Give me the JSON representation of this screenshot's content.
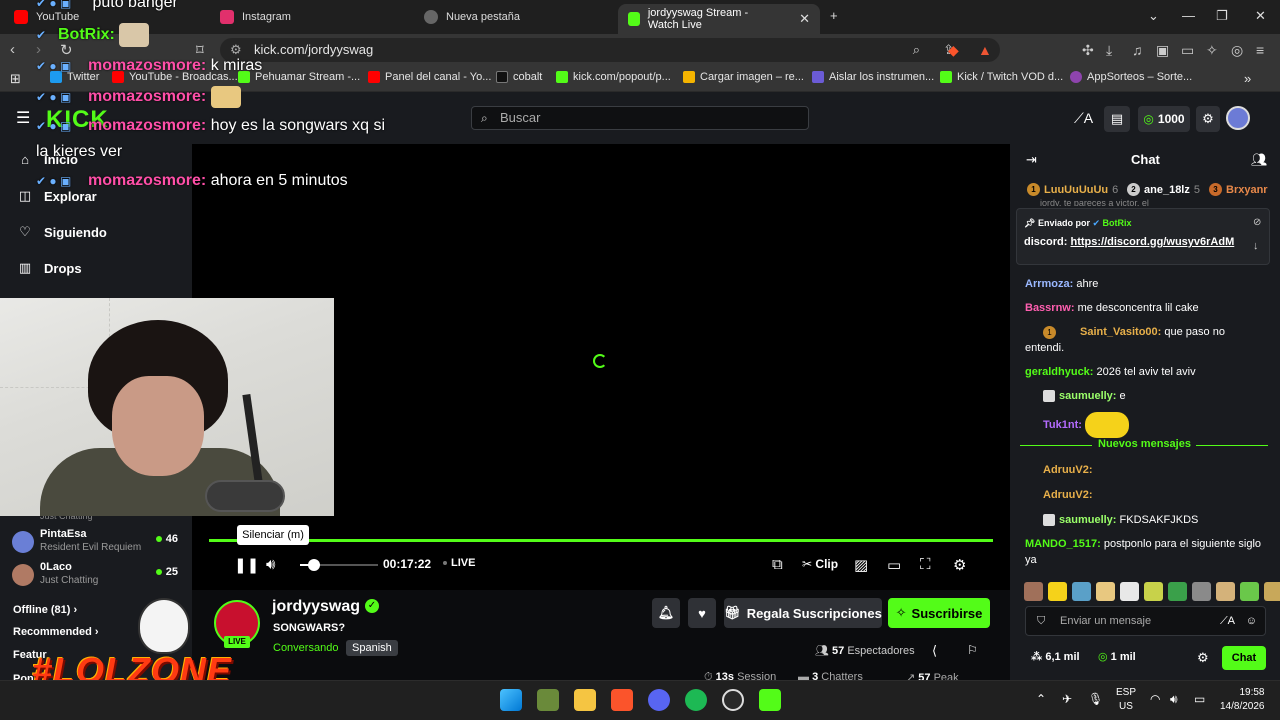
{
  "browser": {
    "tabs": [
      {
        "title": "YouTube",
        "color": "#ff0000"
      },
      {
        "title": "Instagram",
        "color": "#e1306c"
      },
      {
        "title": "Nueva pestaña",
        "color": "#888888"
      },
      {
        "title": "jordyyswag Stream - Watch Live",
        "color": "#53fc18"
      }
    ],
    "url": "kick.com/jordyyswag",
    "bookmarks": [
      {
        "label": "Twitter",
        "color": "#1d9bf0"
      },
      {
        "label": "YouTube - Broadcas...",
        "color": "#ff0000"
      },
      {
        "label": "Pehuamar Stream -...",
        "color": "#53fc18"
      },
      {
        "label": "Panel del canal - Yo...",
        "color": "#ff0000"
      },
      {
        "label": "cobalt",
        "color": "#111111"
      },
      {
        "label": "kick.com/popout/p...",
        "color": "#53fc18"
      },
      {
        "label": "Cargar imagen – re...",
        "color": "#f5b400"
      },
      {
        "label": "Aislar los instrumen...",
        "color": "#6b5bd6"
      },
      {
        "label": "Kick / Twitch VOD d...",
        "color": "#53fc18"
      },
      {
        "label": "AppSorteos – Sorte...",
        "color": "#8e44ad"
      }
    ]
  },
  "kick": {
    "logo": "KICK",
    "search_placeholder": "Buscar",
    "coins": "1000"
  },
  "sidebar": {
    "items": [
      {
        "label": "Inicio"
      },
      {
        "label": "Explorar"
      },
      {
        "label": "Siguiendo"
      },
      {
        "label": "Drops"
      }
    ],
    "partial_game": "Just Chatting",
    "channels": [
      {
        "name": "PintaEsa",
        "game": "Resident Evil Requiem",
        "viewers": "46",
        "color": "#6a7fd6"
      },
      {
        "name": "0Laco",
        "game": "Just Chatting",
        "viewers": "25",
        "color": "#b07a64"
      }
    ],
    "offline": "Offline (81)",
    "recommended": "Recommended",
    "featured": "Featur",
    "partial_link": "Pon"
  },
  "overlay_chat": [
    {
      "user": "",
      "text": "puto banger",
      "bot": false
    },
    {
      "user": "BotRix:",
      "text": "",
      "bot": true
    },
    {
      "user": "momazosmore:",
      "text": "k miras",
      "bot": false
    },
    {
      "user": "momazosmore:",
      "text": "",
      "bot": false
    },
    {
      "user": "momazosmore:",
      "text": "hoy es la songwars xq si",
      "bot": false
    },
    {
      "user": "",
      "text": "la kieres ver",
      "bot": false
    },
    {
      "user": "momazosmore:",
      "text": "ahora en 5 minutos",
      "bot": false
    }
  ],
  "player": {
    "tooltip": "Silenciar (m)",
    "time": "00:17:22",
    "live": "LIVE",
    "clip": "Clip",
    "volume": 0.18
  },
  "stream": {
    "streamer": "jordyyswag",
    "live_tag": "LIVE",
    "title": "SONGWARS?",
    "category": "Conversando",
    "language": "Spanish",
    "gift_label": "Regala Suscripciones",
    "subscribe_label": "Suscribirse",
    "viewers_count": "57",
    "viewers_label": "Espectadores",
    "session_value": "13s",
    "session_label": "Session",
    "chatters_value": "3",
    "chatters_label": "Chatters",
    "peak_value": "57",
    "peak_label": "Peak"
  },
  "overlay_graphics": {
    "lolzone": "#LOLZONE"
  },
  "chat": {
    "title": "Chat",
    "leaderboard": [
      {
        "name": "LuuUuUuUu",
        "count": "6",
        "color": "#e8b04a"
      },
      {
        "name": "ane_18lz",
        "count": "5",
        "color": "#ffffff"
      },
      {
        "name": "Brxyanr",
        "count": "",
        "color": "#e8894a"
      }
    ],
    "cut_line": "jordy, te pareces a victor, el",
    "pinned_by": "Enviado por",
    "pinned_user": "BotRix",
    "pinned_label": "discord:",
    "pinned_link": "https://discord.gg/wusyv6rAdM",
    "messages": [
      {
        "user": "Arrmoza:",
        "text": "ahre",
        "color": "#9ab8ff"
      },
      {
        "user": "Bassrnw:",
        "text": "me desconcentra lil cake",
        "color": "#ff5fb0"
      },
      {
        "user": "Saint_Vasito00:",
        "text": "que paso no",
        "text2": "entendi.",
        "color": "#e8b04a"
      },
      {
        "user": "geraldhyuck:",
        "text": "2026 tel aviv tel aviv",
        "color": "#53fc18"
      },
      {
        "user": "saumuelly:",
        "text": "e",
        "color": "#9bff6a"
      },
      {
        "user": "Tuk1nt:",
        "text": "",
        "color": "#b46bff"
      },
      {
        "user": "AdruuV2:",
        "text": "",
        "color": "#e8b04a"
      },
      {
        "user": "AdruuV2:",
        "text": "",
        "color": "#e8b04a"
      },
      {
        "user": "saumuelly:",
        "text": "FKDSAKFJKDS",
        "color": "#9bff6a"
      },
      {
        "user": "MANDO_1517:",
        "text": "postponlo para el siguiente siglo",
        "text2": "ya",
        "color": "#53fc18"
      }
    ],
    "new_messages": "Nuevos mensajes",
    "input_placeholder": "Enviar un mensaje",
    "followers": "6,1 mil",
    "coins": "1 mil",
    "send": "Chat"
  },
  "taskbar": {
    "lang1": "ESP",
    "lang2": "US",
    "time": "19:58",
    "date": "14/8/2026"
  }
}
